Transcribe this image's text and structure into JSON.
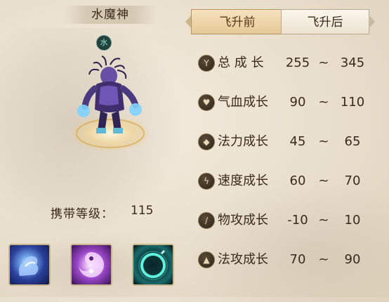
{
  "pet": {
    "name": "水魔神",
    "element_badge": "水",
    "carry_level_label": "携带等级：",
    "carry_level_value": "115"
  },
  "skills": [
    {
      "icon": "blue-hand-spell-icon"
    },
    {
      "icon": "purple-vortex-icon"
    },
    {
      "icon": "teal-ring-icon"
    }
  ],
  "tabs": [
    {
      "label": "飞升前",
      "selected": true
    },
    {
      "label": "飞升后",
      "selected": false
    }
  ],
  "stats": [
    {
      "label": "总 成 长",
      "min": "255",
      "tilde": "~",
      "max": "345",
      "icon": "total-growth-icon"
    },
    {
      "label": "气血成长",
      "min": "90",
      "tilde": "~",
      "max": "110",
      "icon": "heart-icon"
    },
    {
      "label": "法力成长",
      "min": "45",
      "tilde": "~",
      "max": "65",
      "icon": "mana-drop-icon"
    },
    {
      "label": "速度成长",
      "min": "60",
      "tilde": "~",
      "max": "70",
      "icon": "speed-icon"
    },
    {
      "label": "物攻成长",
      "min": "-10",
      "tilde": "~",
      "max": "10",
      "icon": "sword-icon"
    },
    {
      "label": "法攻成长",
      "min": "70",
      "tilde": "~",
      "max": "90",
      "icon": "flame-icon"
    }
  ],
  "colors": {
    "selected_tab": "#f0d7a8",
    "unselected_tab": "#f7f1e5",
    "text": "#3a2a1a"
  }
}
